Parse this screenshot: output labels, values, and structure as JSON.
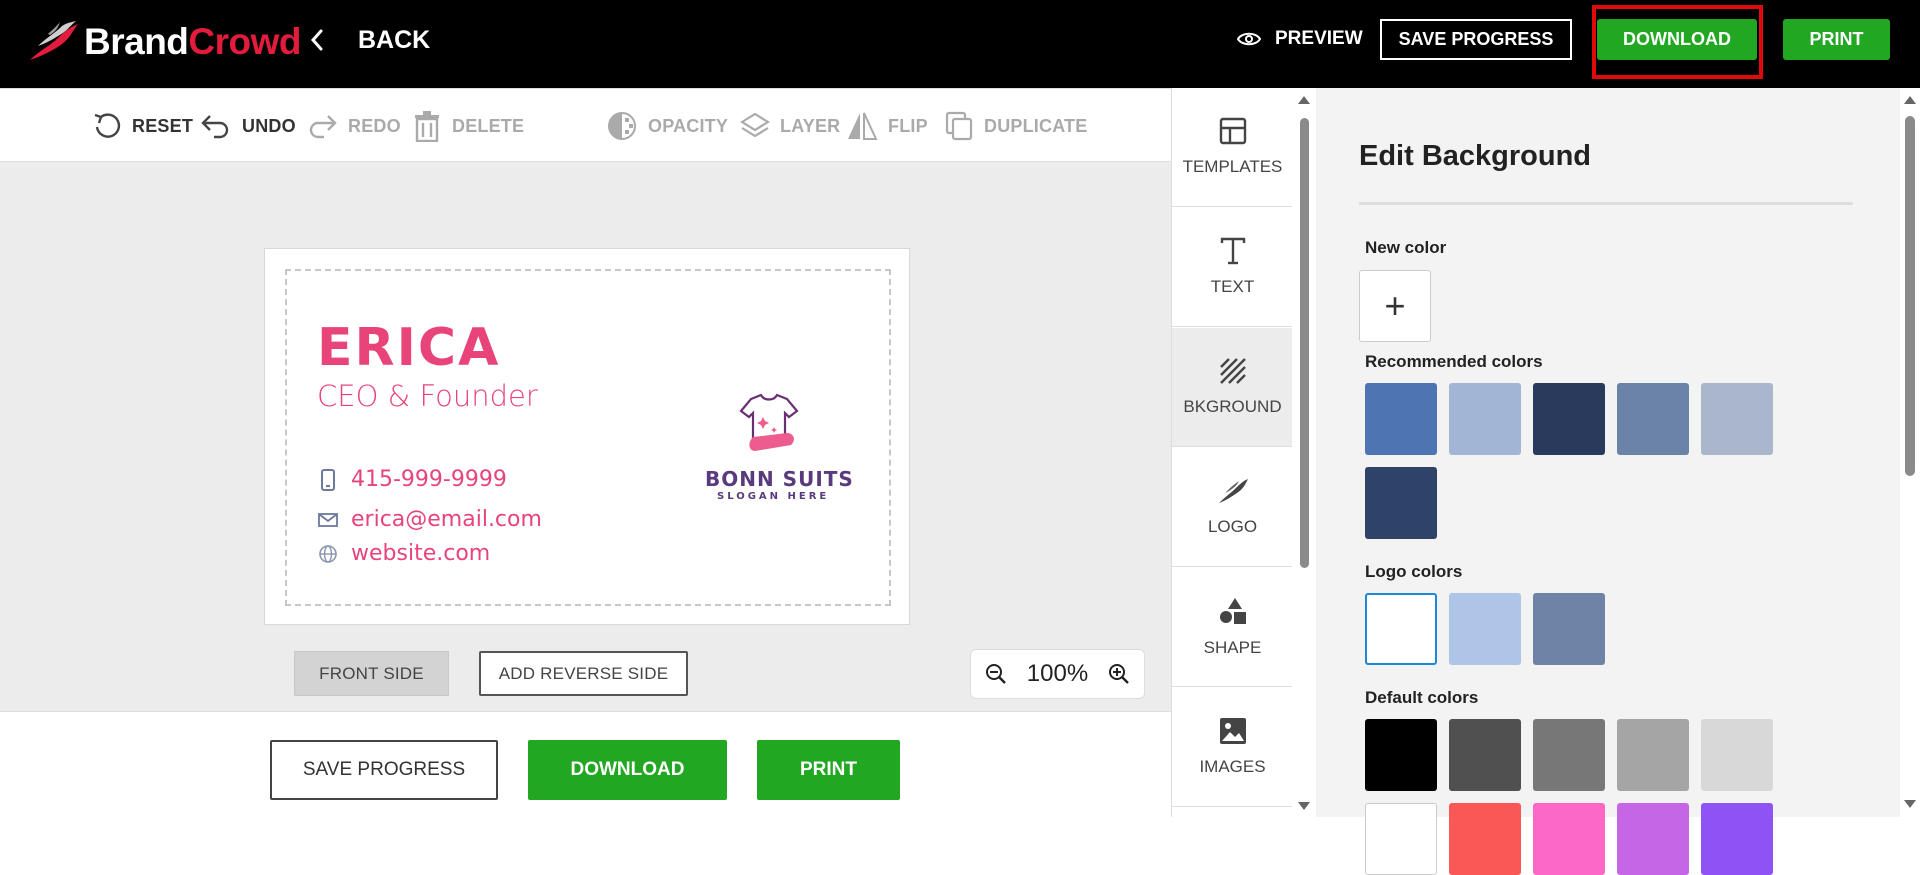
{
  "header": {
    "brand_first": "Brand",
    "brand_second": "Crowd",
    "back_label": "BACK",
    "preview_label": "PREVIEW",
    "save_label": "SAVE PROGRESS",
    "download_label": "DOWNLOAD",
    "print_label": "PRINT"
  },
  "toolbar": {
    "reset": "RESET",
    "undo": "UNDO",
    "redo": "REDO",
    "delete": "DELETE",
    "opacity": "OPACITY",
    "layer": "LAYER",
    "flip": "FLIP",
    "duplicate": "DUPLICATE"
  },
  "card": {
    "name": "ERICA",
    "title": "CEO & Founder",
    "phone": "415-999-9999",
    "email": "erica@email.com",
    "website": "website.com",
    "logo_name": "BONN SUITS",
    "logo_slogan": "SLOGAN HERE"
  },
  "canvas": {
    "front_side": "FRONT SIDE",
    "add_reverse": "ADD REVERSE SIDE",
    "zoom": "100%"
  },
  "bottom": {
    "save_label": "SAVE PROGRESS",
    "download_label": "DOWNLOAD",
    "print_label": "PRINT"
  },
  "nav": {
    "templates": "TEMPLATES",
    "text": "TEXT",
    "background": "BKGROUND",
    "logo": "LOGO",
    "shape": "SHAPE",
    "images": "IMAGES"
  },
  "panel": {
    "title": "Edit Background",
    "new_color": "New color",
    "recommended": "Recommended colors",
    "logo_colors": "Logo colors",
    "default_colors": "Default colors",
    "add_symbol": "+",
    "recommended_swatches": [
      "#4e74b1",
      "#a3b5d5",
      "#293a5d",
      "#6a83a6",
      "#a9b6cc",
      "#2f4268"
    ],
    "logo_swatches": [
      "#ffffff",
      "#aec5e8",
      "#6f83a6"
    ],
    "default_swatches": [
      "#000000",
      "#505050",
      "#777777",
      "#a5a5a5",
      "#d8d8d8",
      "#ffffff",
      "#fa5757",
      "#fb68c5",
      "#c566e6",
      "#8e52f5"
    ]
  },
  "colors": {
    "accent_green": "#22a722",
    "brand_red": "#e31c3d",
    "card_pink": "#e8447a",
    "highlight_red": "#e10a0a"
  }
}
